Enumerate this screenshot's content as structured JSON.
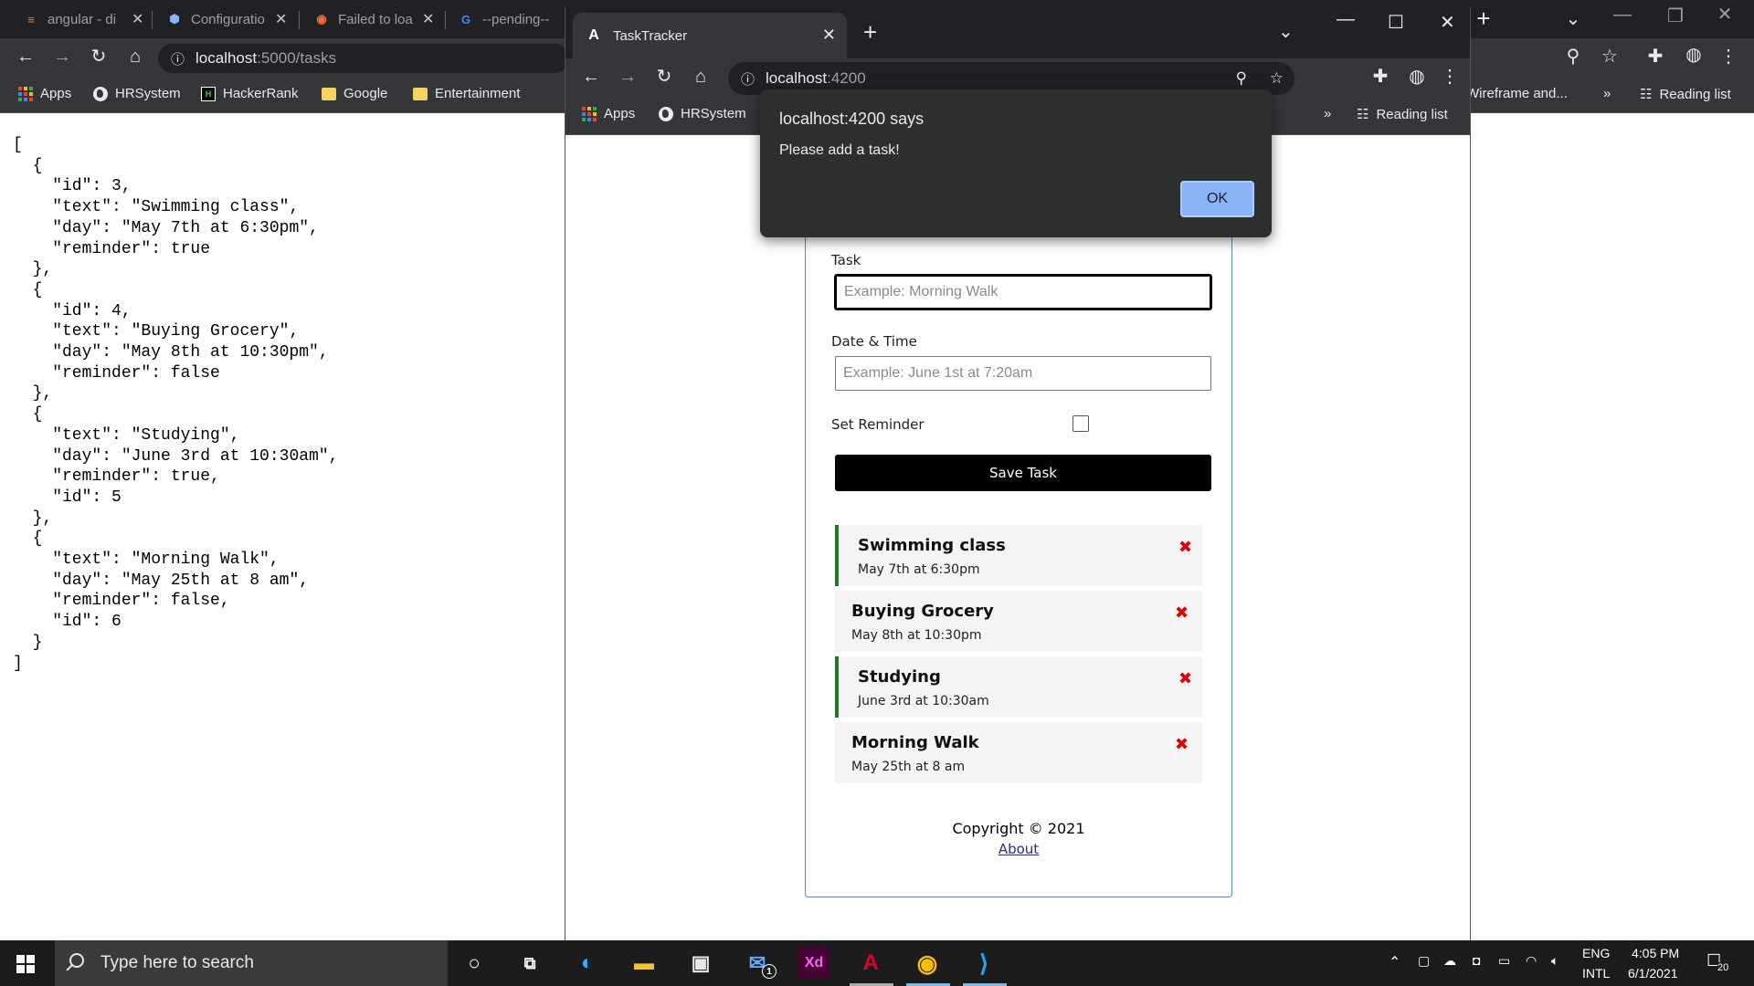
{
  "back_window": {
    "tabs": [
      {
        "title": "angular - di",
        "favicon": "stackoverflow-icon"
      },
      {
        "title": "Configuratio",
        "favicon": "settings-icon"
      },
      {
        "title": "Failed to loa",
        "favicon": "postman-icon"
      },
      {
        "title": "--pending--",
        "favicon": "google-icon"
      }
    ],
    "url_host": "localhost",
    "url_path": ":5000/tasks",
    "bookmarks": [
      "Apps",
      "HRSystem",
      "HackerRank",
      "Google",
      "Entertainment"
    ],
    "bookmark_right": "Wireframe and...",
    "reading_list": "Reading list",
    "json_lines": [
      "[",
      "  {",
      "    \"id\": 3,",
      "    \"text\": \"Swimming class\",",
      "    \"day\": \"May 7th at 6:30pm\",",
      "    \"reminder\": true",
      "  },",
      "  {",
      "    \"id\": 4,",
      "    \"text\": \"Buying Grocery\",",
      "    \"day\": \"May 8th at 10:30pm\",",
      "    \"reminder\": false",
      "  },",
      "  {",
      "    \"text\": \"Studying\",",
      "    \"day\": \"June 3rd at 10:30am\",",
      "    \"reminder\": true,",
      "    \"id\": 5",
      "  },",
      "  {",
      "    \"text\": \"Morning Walk\",",
      "    \"day\": \"May 25th at 8 am\",",
      "    \"reminder\": false,",
      "    \"id\": 6",
      "  }",
      "]"
    ]
  },
  "front_window": {
    "tab_title": "TaskTracker",
    "url_host": "localhost",
    "url_port": ":4200",
    "bookmarks": [
      "Apps",
      "HRSystem"
    ],
    "reading_list": "Reading list",
    "alert": {
      "title": "localhost:4200 says",
      "message": "Please add a task!",
      "ok_label": "OK"
    },
    "form": {
      "task_label": "Task",
      "task_placeholder": "Example: Morning Walk",
      "day_label": "Date & Time",
      "day_placeholder": "Example: June 1st at 7:20am",
      "reminder_label": "Set Reminder",
      "save_label": "Save Task"
    },
    "tasks": [
      {
        "text": "Swimming class",
        "day": "May 7th at 6:30pm",
        "reminder": true
      },
      {
        "text": "Buying Grocery",
        "day": "May 8th at 10:30pm",
        "reminder": false
      },
      {
        "text": "Studying",
        "day": "June 3rd at 10:30am",
        "reminder": true
      },
      {
        "text": "Morning Walk",
        "day": "May 25th at 8 am",
        "reminder": false
      }
    ],
    "delete_glyph": "✖",
    "footer": {
      "copyright": "Copyright © 2021",
      "about": "About"
    }
  },
  "taskbar": {
    "search_placeholder": "Type here to search",
    "mail_badge": "1",
    "language": "ENG",
    "layout": "INTL",
    "time": "4:05 PM",
    "date": "6/1/2021",
    "notification_count": "20"
  },
  "colors": {
    "reminder_border": "#1e7b1e",
    "delete_red": "#e00000",
    "alert_ok": "#8ab4f8",
    "card_border": "#5a8db8"
  }
}
